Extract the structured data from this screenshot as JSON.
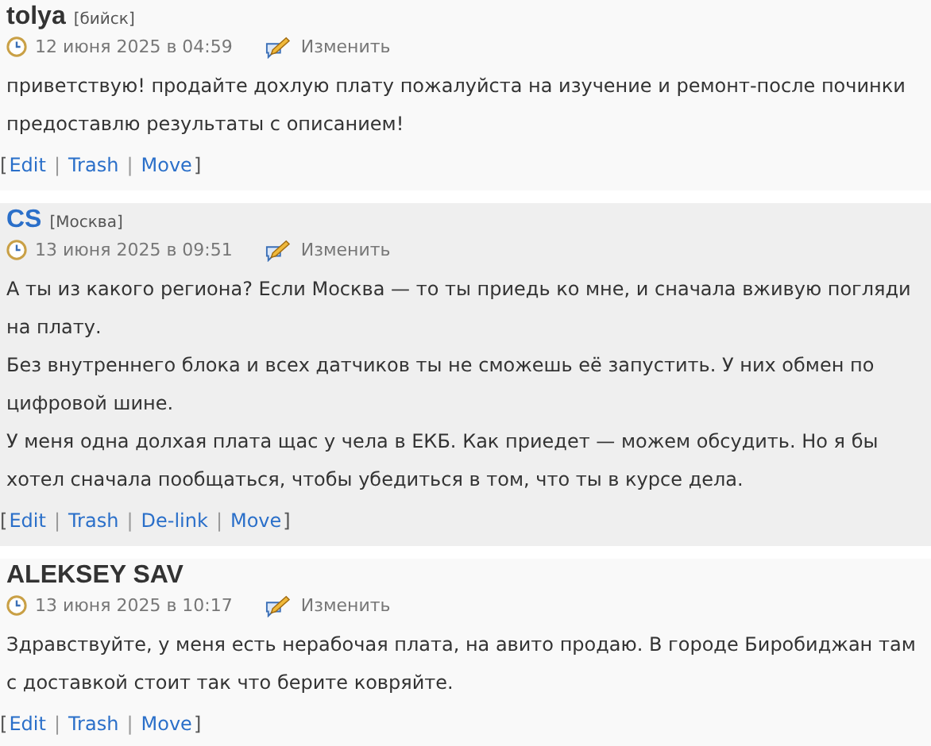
{
  "comments": [
    {
      "author": "tolya",
      "location": "[бийск]",
      "highlighted": false,
      "date": "12 июня 2025 в 04:59",
      "edit": "Изменить",
      "paragraphs": [
        "приветствую! продайте дохлую плату пожалуйста на изучение и ремонт-после починки предоставлю результаты с описанием!"
      ],
      "links": {
        "open": "[",
        "separator": "|",
        "close": "]",
        "items": [
          "Edit",
          "Trash",
          "Move"
        ]
      }
    },
    {
      "author": "CS",
      "location": "[Москва]",
      "highlighted": true,
      "date": "13 июня 2025 в 09:51",
      "edit": "Изменить",
      "paragraphs": [
        "А ты из какого региона? Если Москва — то ты приедь ко мне, и сначала вживую погляди на плату.",
        "Без внутреннего блока и всех датчиков ты не сможешь её запустить. У них обмен по цифровой шине.",
        "У меня одна долхая плата щас у чела в ЕКБ. Как приедет — можем обсудить. Но я бы хотел сначала пообщаться, чтобы убедиться в том, что ты в курсе дела."
      ],
      "links": {
        "open": "[",
        "separator": "|",
        "close": "]",
        "items": [
          "Edit",
          "Trash",
          "De-link",
          "Move"
        ]
      }
    },
    {
      "author": "ALEKSEY SAV",
      "highlighted": false,
      "date": "13 июня 2025 в 10:17",
      "edit": "Изменить",
      "paragraphs": [
        "Здравствуйте, у меня есть нерабочая плата, на авито продаю. В городе Биробиджан там с доставкой стоит так что берите ковряйте."
      ],
      "links": {
        "open": "[",
        "separator": "|",
        "close": "]",
        "items": [
          "Edit",
          "Trash",
          "Move"
        ]
      }
    }
  ]
}
